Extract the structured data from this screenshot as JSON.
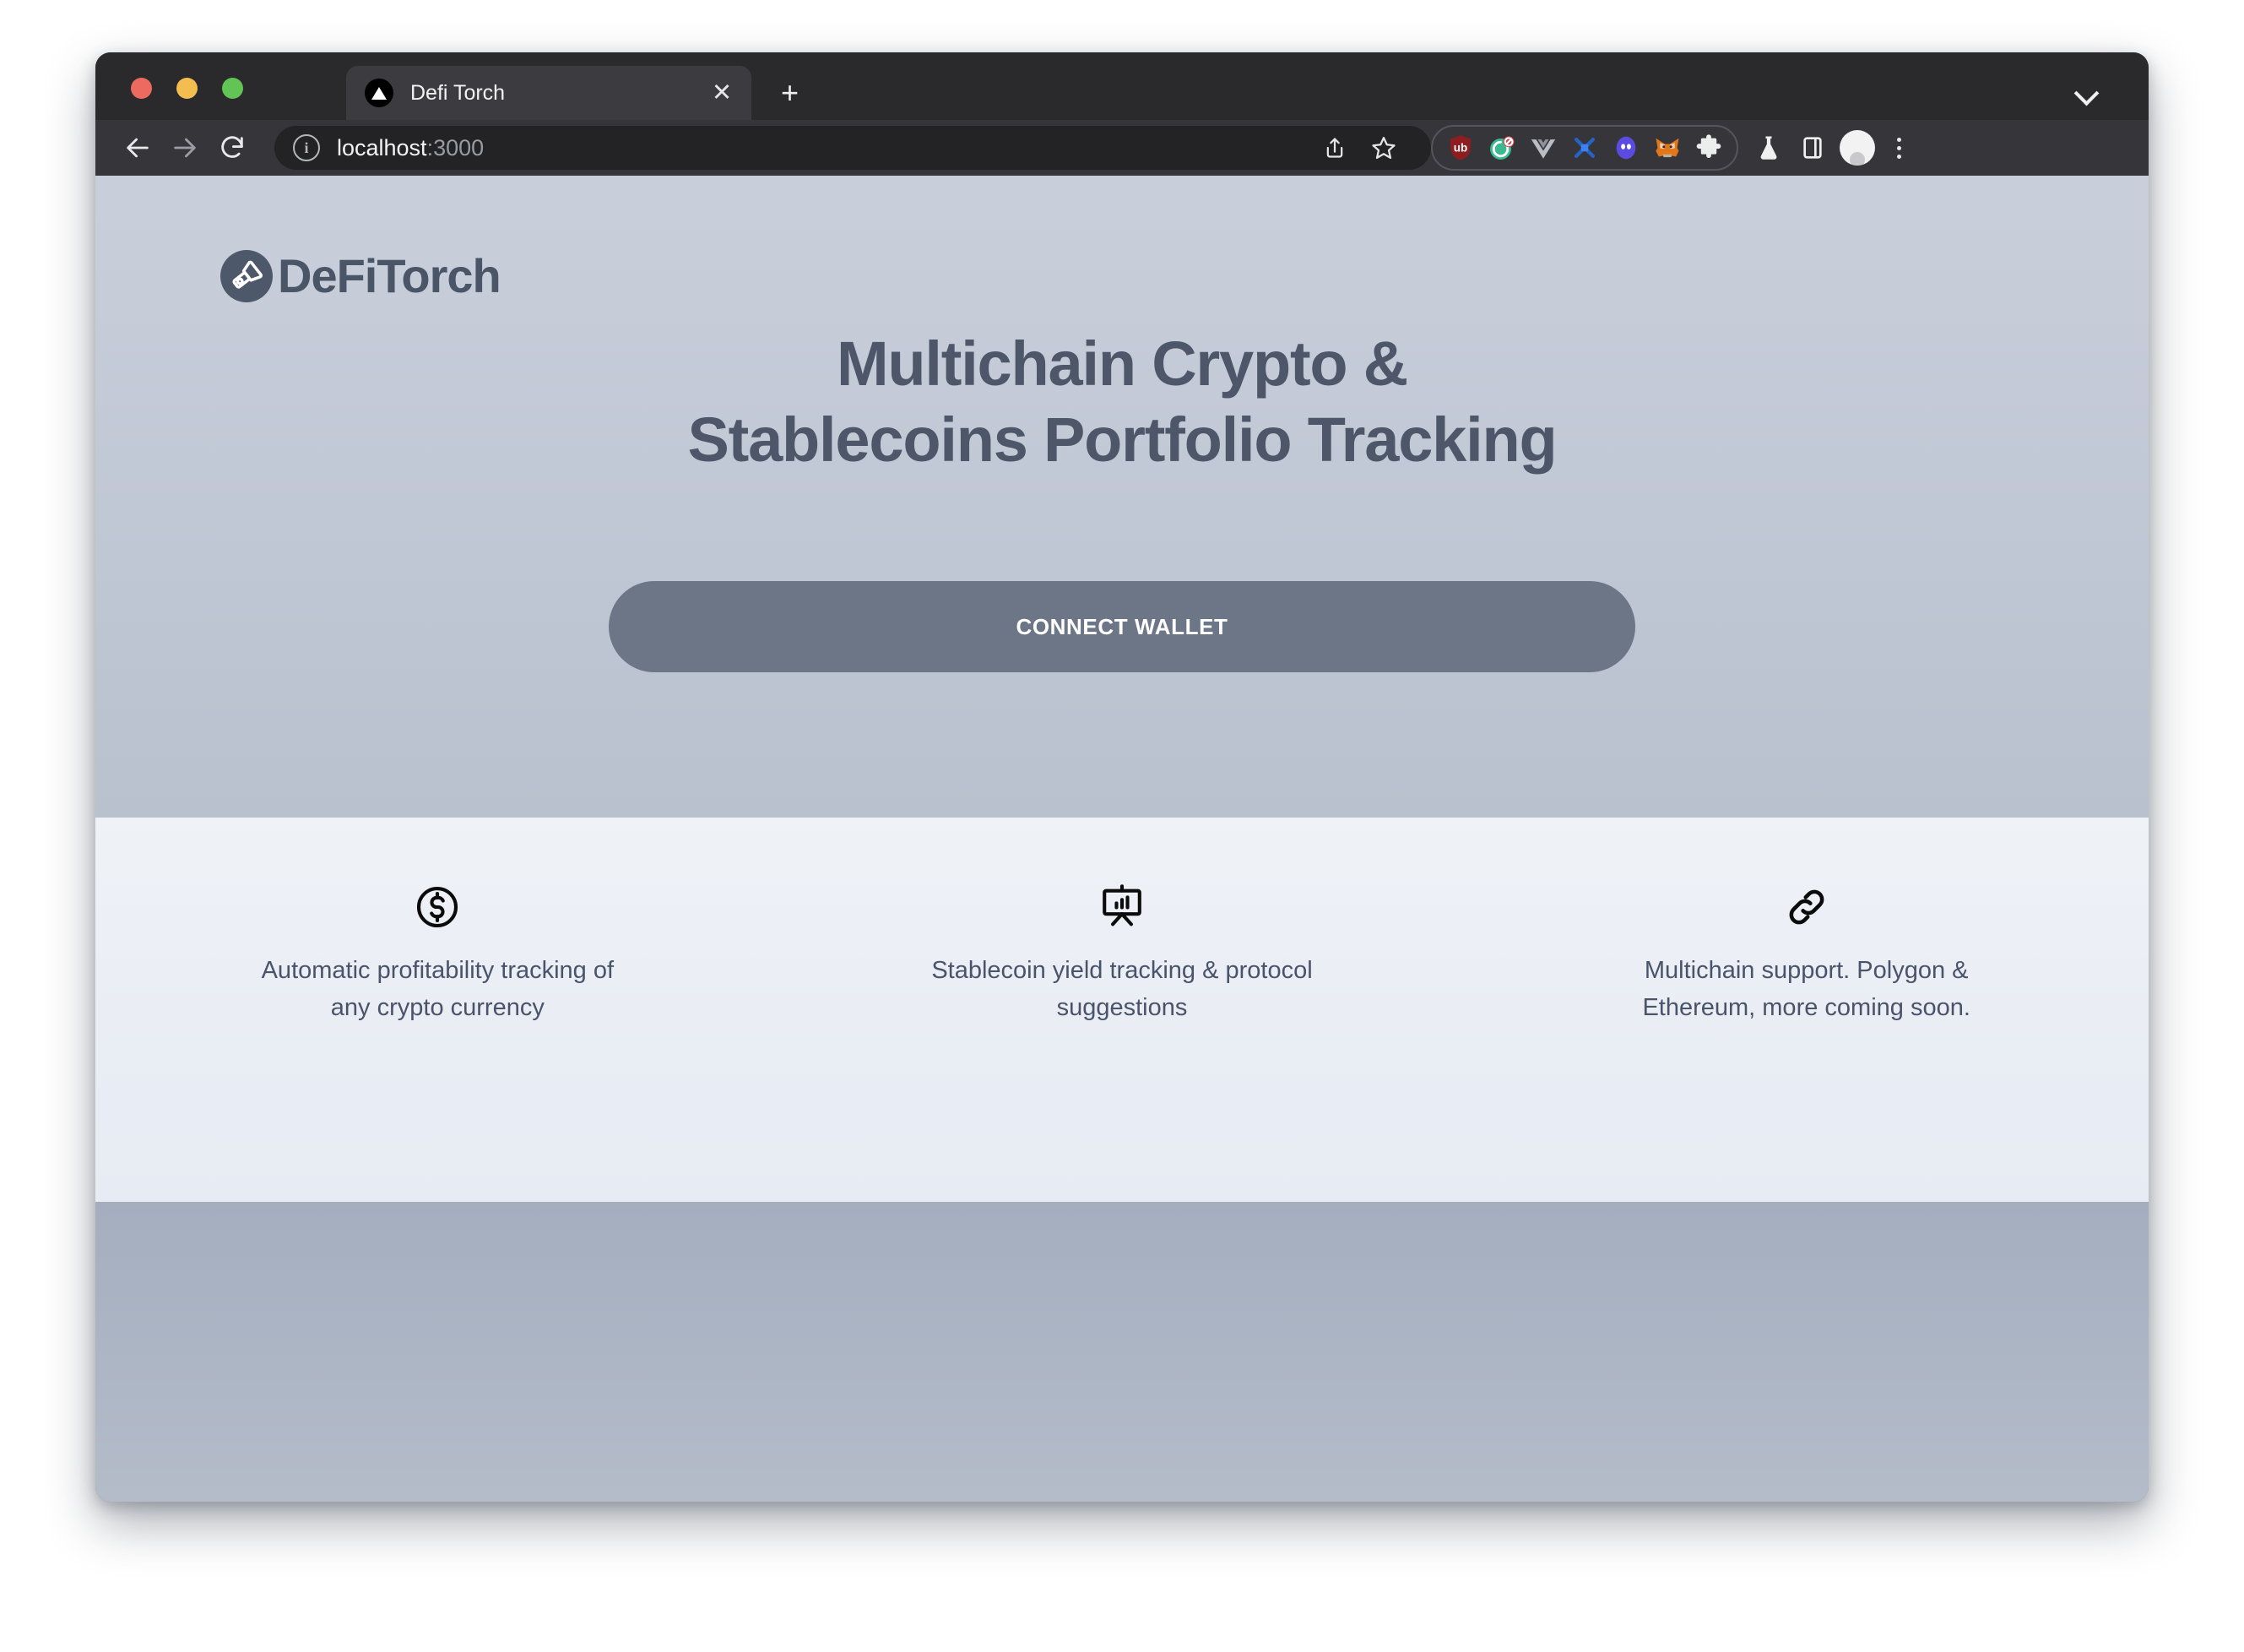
{
  "browser": {
    "tab": {
      "title": "Defi Torch",
      "favicon_icon": "triangle-logo-icon",
      "close_icon": "close-icon"
    },
    "new_tab_label": "+",
    "tab_search_icon": "chevron-down-icon",
    "toolbar": {
      "back_icon": "back-arrow-icon",
      "forward_icon": "forward-arrow-icon",
      "reload_icon": "reload-icon",
      "info_icon": "info-circle-icon",
      "url_host": "localhost",
      "url_port": ":3000",
      "share_icon": "share-icon",
      "bookmark_icon": "star-icon",
      "extensions": [
        "ublock-origin-icon",
        "ghostery-icon",
        "vue-devtools-icon",
        "pocket-universe-icon",
        "phantom-wallet-icon",
        "metamask-fox-icon",
        "puzzle-extensions-icon"
      ],
      "lab_icon": "flask-icon",
      "side_panel_icon": "side-panel-icon",
      "profile_icon": "avatar-icon",
      "menu_icon": "kebab-menu-icon"
    }
  },
  "page": {
    "logo": {
      "mark_icon": "flashlight-torch-icon",
      "text": "DeFiTorch"
    },
    "hero": {
      "headline_line1": "Multichain Crypto &",
      "headline_line2": "Stablecoins Portfolio Tracking",
      "cta_label": "CONNECT WALLET"
    },
    "features": [
      {
        "icon": "dollar-circle-icon",
        "text": "Automatic profitability tracking of any crypto currency"
      },
      {
        "icon": "presentation-chart-icon",
        "text": "Stablecoin yield tracking & protocol suggestions"
      },
      {
        "icon": "chain-link-icon",
        "text": "Multichain support. Polygon & Ethereum, more coming soon."
      }
    ]
  },
  "colors": {
    "hero_bg_top": "#c9cfda",
    "hero_bg_bottom": "#b9c1ce",
    "features_bg": "#eff2f7",
    "bottom_band": "#a4aebf",
    "brand_text": "#4a5568",
    "cta_bg": "#6c7687",
    "cta_text": "#ffffff",
    "body_text": "#49536a",
    "chrome_bg": "#2a2a2d",
    "toolbar_bg": "#35353a",
    "omnibox_bg": "#232326",
    "traffic_red": "#ec6a5f",
    "traffic_yellow": "#f4bd4f",
    "traffic_green": "#61c454"
  }
}
